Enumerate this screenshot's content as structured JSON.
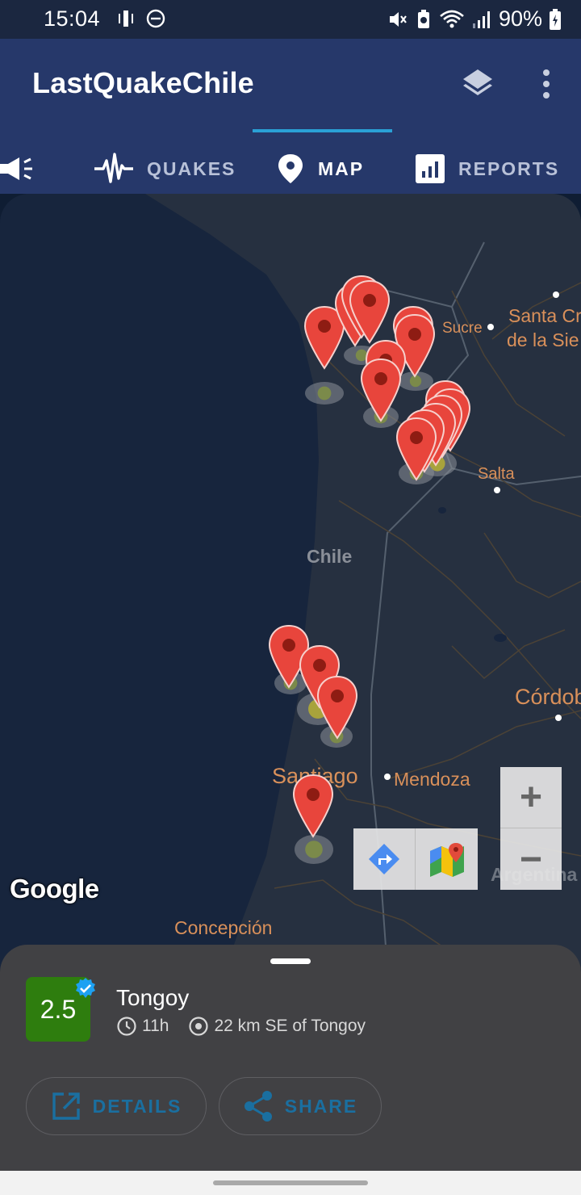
{
  "status_bar": {
    "time": "15:04",
    "battery": "90%",
    "icons": [
      "vibrate-icon",
      "dnd-icon",
      "mute-icon",
      "battery-saver-icon",
      "wifi-icon",
      "signal-icon",
      "battery-charging-icon"
    ]
  },
  "app_bar": {
    "title": "LastQuakeChile",
    "actions": [
      "layers-icon",
      "more-vert-icon"
    ]
  },
  "tabs": [
    {
      "icon": "megaphone-icon",
      "label": ""
    },
    {
      "icon": "seismograph-icon",
      "label": "QUAKES"
    },
    {
      "icon": "map-pin-icon",
      "label": "MAP",
      "active": true
    },
    {
      "icon": "bar-chart-icon",
      "label": "REPORTS"
    }
  ],
  "map": {
    "labels": {
      "santa_cruz_1": "Santa Cr",
      "santa_cruz_2": "de la Sie",
      "sucre": "Sucre",
      "salta": "Salta",
      "chile": "Chile",
      "cordoba": "Córdob",
      "santiago": "Santiago",
      "mendoza": "Mendoza",
      "argentina": "Argentina",
      "concepcion": "Concepción"
    },
    "attribution": "Google",
    "zoom_in": "+",
    "zoom_out": "−",
    "marker_count": 18
  },
  "detail_sheet": {
    "magnitude": "2.5",
    "verified": true,
    "place": "Tongoy",
    "time_ago": "11h",
    "distance": "22 km SE of Tongoy",
    "details_label": "DETAILS",
    "share_label": "SHARE",
    "colors": {
      "magnitude_bg": "#2e7d0e",
      "accent": "#1a6fa0",
      "verified": "#1da1f2"
    }
  }
}
